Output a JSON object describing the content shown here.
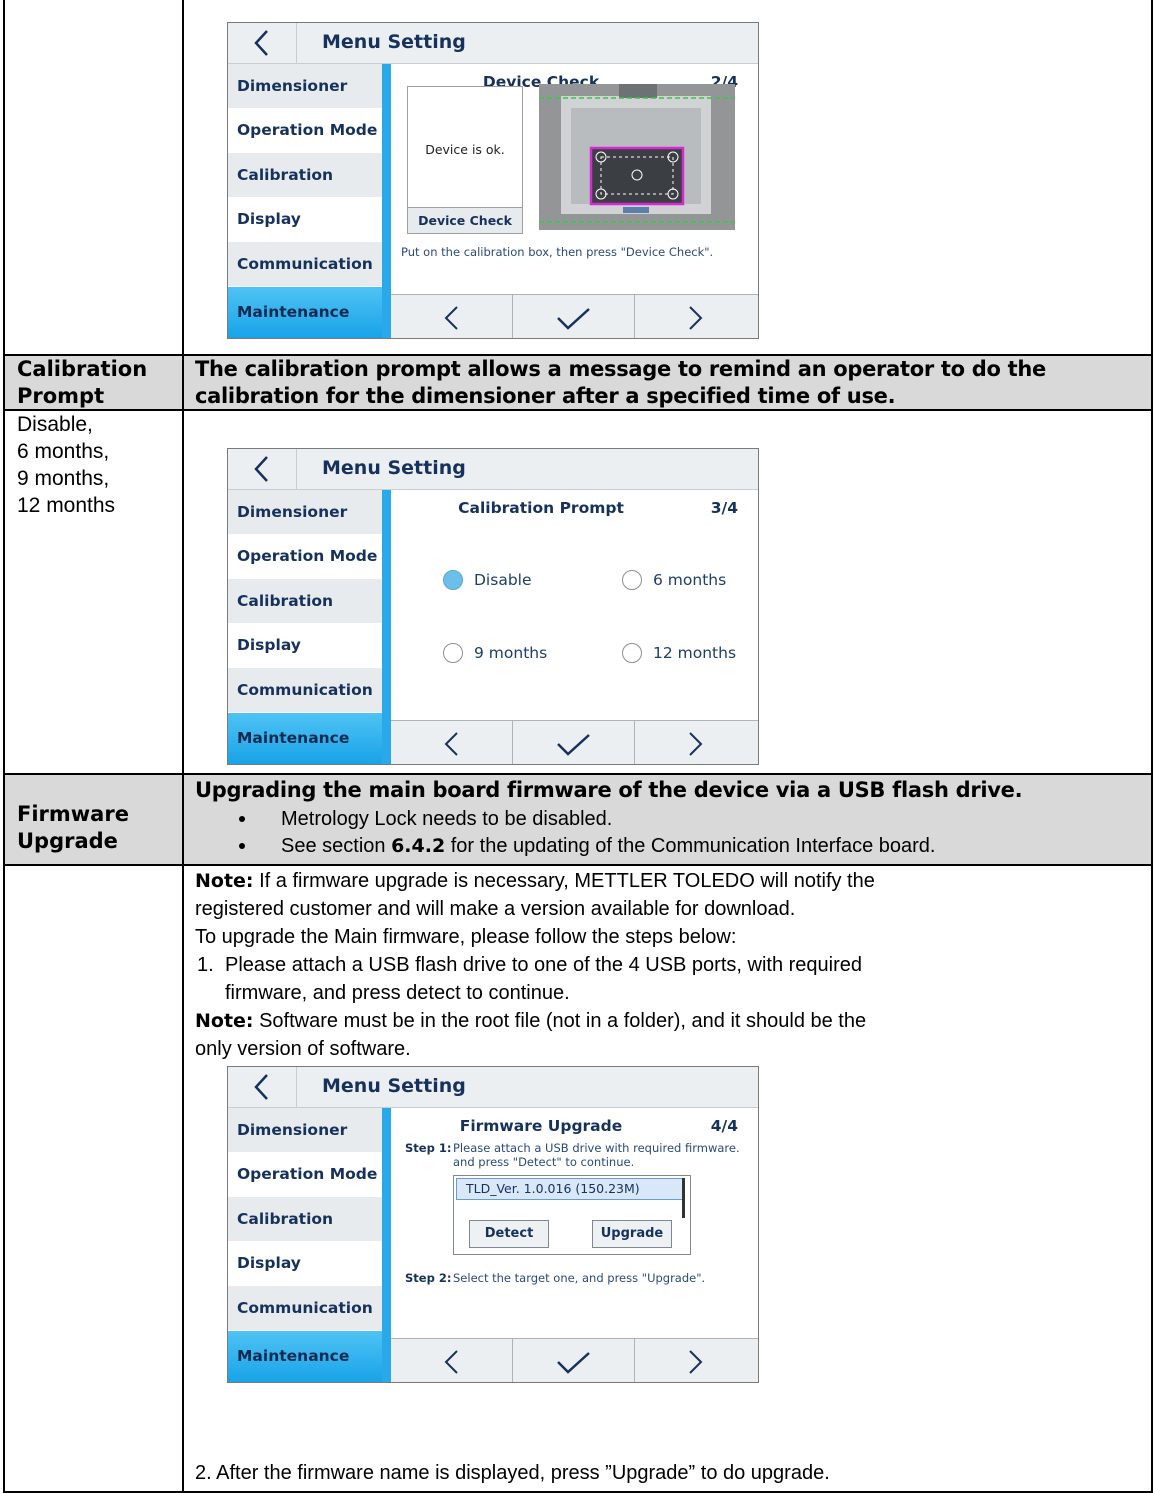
{
  "screen_common": {
    "title": "Menu Setting",
    "menu": [
      "Dimensioner",
      "Operation Mode",
      "Calibration",
      "Display",
      "Communication",
      "Maintenance"
    ]
  },
  "screen1": {
    "heading": "Device Check",
    "page": "2/4",
    "status": "Device is ok.",
    "button": "Device Check",
    "hint": "Put on the calibration box, then press \"Device Check\"."
  },
  "row_calib": {
    "label_line1": "Calibration",
    "label_line2": "Prompt",
    "desc_line1": "The calibration prompt allows a message to remind an operator to do the",
    "desc_line2": "calibration for the dimensioner after a specified time of use.",
    "options_text": [
      "Disable,",
      "6 months,",
      "9 months,",
      "12 months"
    ]
  },
  "screen2": {
    "heading": "Calibration Prompt",
    "page": "3/4",
    "options": [
      {
        "label": "Disable",
        "selected": true
      },
      {
        "label": "6 months",
        "selected": false
      },
      {
        "label": "9 months",
        "selected": false
      },
      {
        "label": "12 months",
        "selected": false
      }
    ]
  },
  "row_firmware": {
    "label_line1": "Firmware",
    "label_line2": "Upgrade",
    "desc": "Upgrading the main board firmware of the device via a USB flash drive.",
    "bullet1": "Metrology Lock needs to be disabled.",
    "bullet2_pre": "See section ",
    "bullet2_bold": "6.4.2",
    "bullet2_post": " for the updating of the Communication Interface board."
  },
  "notes": {
    "note_label": "Note:",
    "note1_line1": " If a firmware upgrade is necessary, METTLER TOLEDO will notify the",
    "note1_line2": "registered customer and will make a version available for download.",
    "intro": "To upgrade the Main firmware, please follow the steps below:",
    "step1_num": "1.",
    "step1_line1": "Please attach a USB flash drive to one of the 4 USB ports, with required",
    "step1_line2": "firmware, and press detect to continue.",
    "note2_line1": " Software must be in the root file (not in a folder), and it should be the",
    "note2_line2": "only version of software.",
    "step2": "2. After the firmware name is displayed, press ”Upgrade” to do upgrade."
  },
  "screen3": {
    "heading": "Firmware Upgrade",
    "page": "4/4",
    "step1_label": "Step 1:",
    "step1_line1": "Please attach a USB drive with required firmware.",
    "step1_line2": "and press \"Detect\" to continue.",
    "list_item": "TLD_Ver. 1.0.016 (150.23M)",
    "detect": "Detect",
    "upgrade": "Upgrade",
    "step2_label": "Step 2:",
    "step2_text": "Select the target one, and press \"Upgrade\"."
  }
}
